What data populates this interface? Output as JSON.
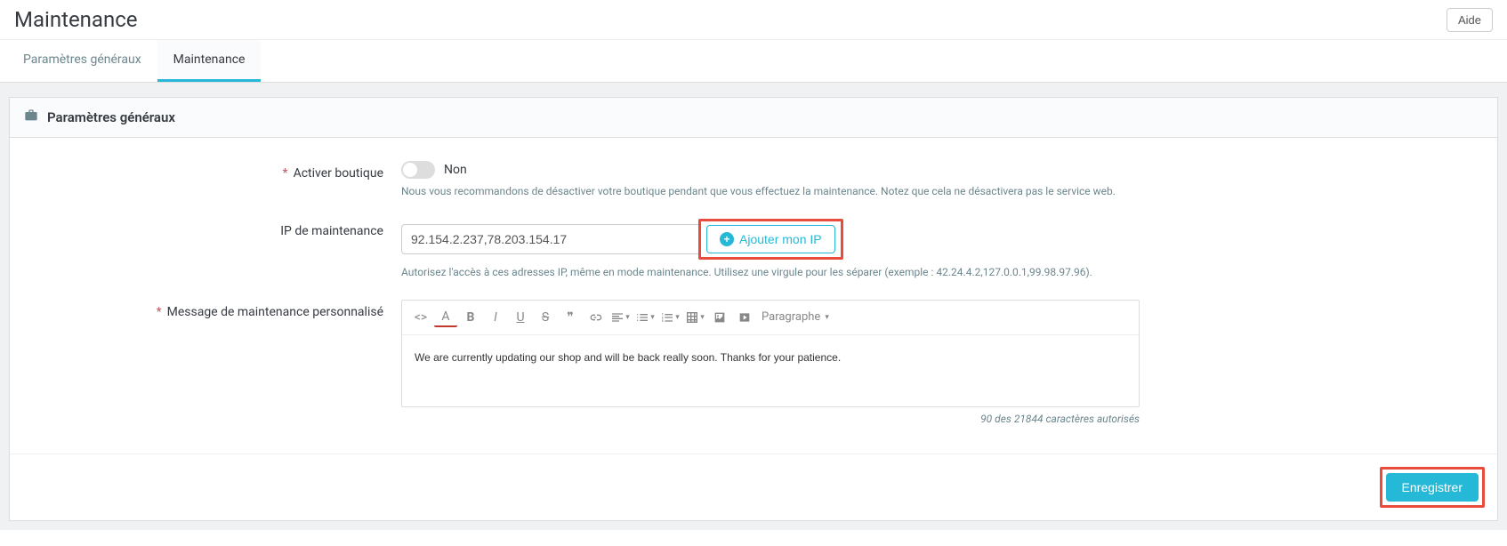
{
  "header": {
    "title": "Maintenance",
    "help": "Aide"
  },
  "tabs": {
    "general": "Paramètres généraux",
    "maintenance": "Maintenance"
  },
  "panel": {
    "title": "Paramètres généraux"
  },
  "form": {
    "enable_shop": {
      "label": "Activer boutique",
      "value": "Non",
      "hint": "Nous vous recommandons de désactiver votre boutique pendant que vous effectuez la maintenance. Notez que cela ne désactivera pas le service web."
    },
    "maintenance_ip": {
      "label": "IP de maintenance",
      "value": "92.154.2.237,78.203.154.17",
      "add_button": "Ajouter mon IP",
      "hint": "Autorisez l'accès à ces adresses IP, même en mode maintenance. Utilisez une virgule pour les séparer (exemple : 42.24.4.2,127.0.0.1,99.98.97.96)."
    },
    "custom_message": {
      "label": "Message de maintenance personnalisé",
      "paragraph_label": "Paragraphe",
      "content": "We are currently updating our shop and will be back really soon. Thanks for your patience.",
      "char_count": "90 des 21844 caractères autorisés"
    }
  },
  "footer": {
    "save": "Enregistrer"
  }
}
